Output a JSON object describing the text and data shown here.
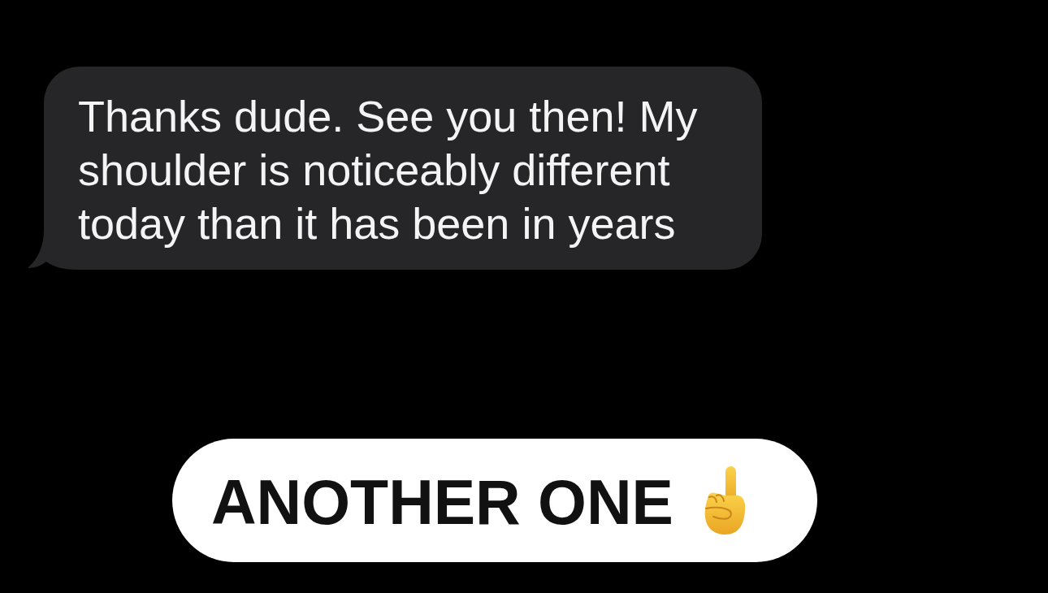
{
  "message": {
    "text": "Thanks dude. See you then! My shoulder is noticeably different today than it has been in years"
  },
  "caption": {
    "text": "ANOTHER ONE"
  }
}
